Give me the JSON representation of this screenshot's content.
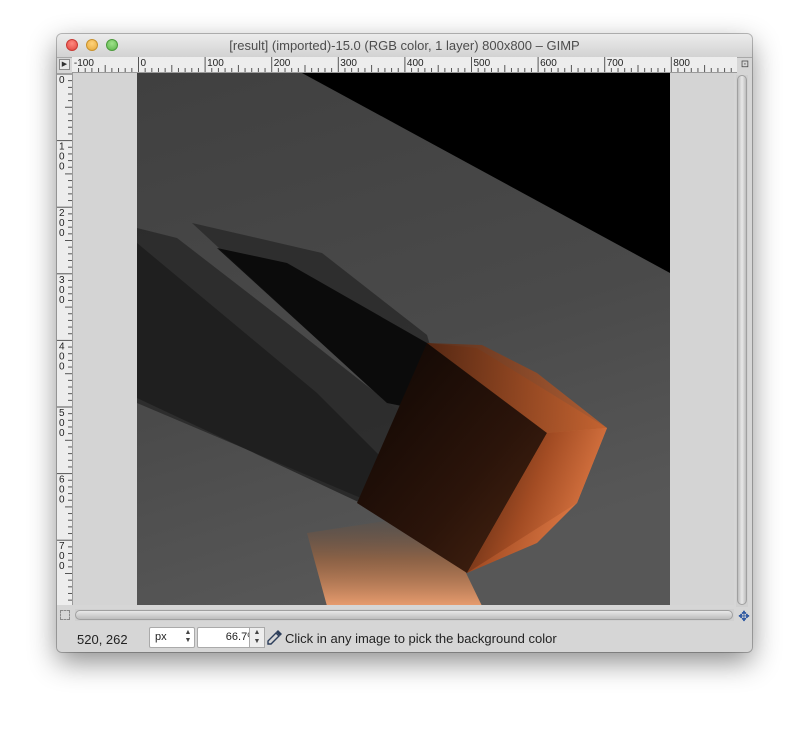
{
  "window": {
    "title": "[result] (imported)-15.0 (RGB color, 1 layer) 800x800 – GIMP"
  },
  "rulers": {
    "horizontal_labels": [
      "-100",
      "0",
      "100",
      "200",
      "300",
      "400",
      "500",
      "600",
      "700",
      "800"
    ],
    "vertical_labels": [
      "0",
      "100",
      "200",
      "300",
      "400",
      "500",
      "600",
      "700"
    ]
  },
  "statusbar": {
    "coordinates": "520, 262",
    "unit": "px",
    "zoom": "66.7%",
    "message": "Click in any image to pick the background color"
  },
  "icons": {
    "close": "close-traffic-light",
    "minimize": "minimize-traffic-light",
    "maximize": "maximize-traffic-light",
    "navigate": "navigate-cross-icon",
    "color_picker": "color-picker-icon",
    "quick_mask": "quick-mask-icon"
  },
  "colors": {
    "canvas_background": "#d4d4d4",
    "wood_highlight": "#e07a45",
    "wood_dark": "#3a1a0c"
  }
}
